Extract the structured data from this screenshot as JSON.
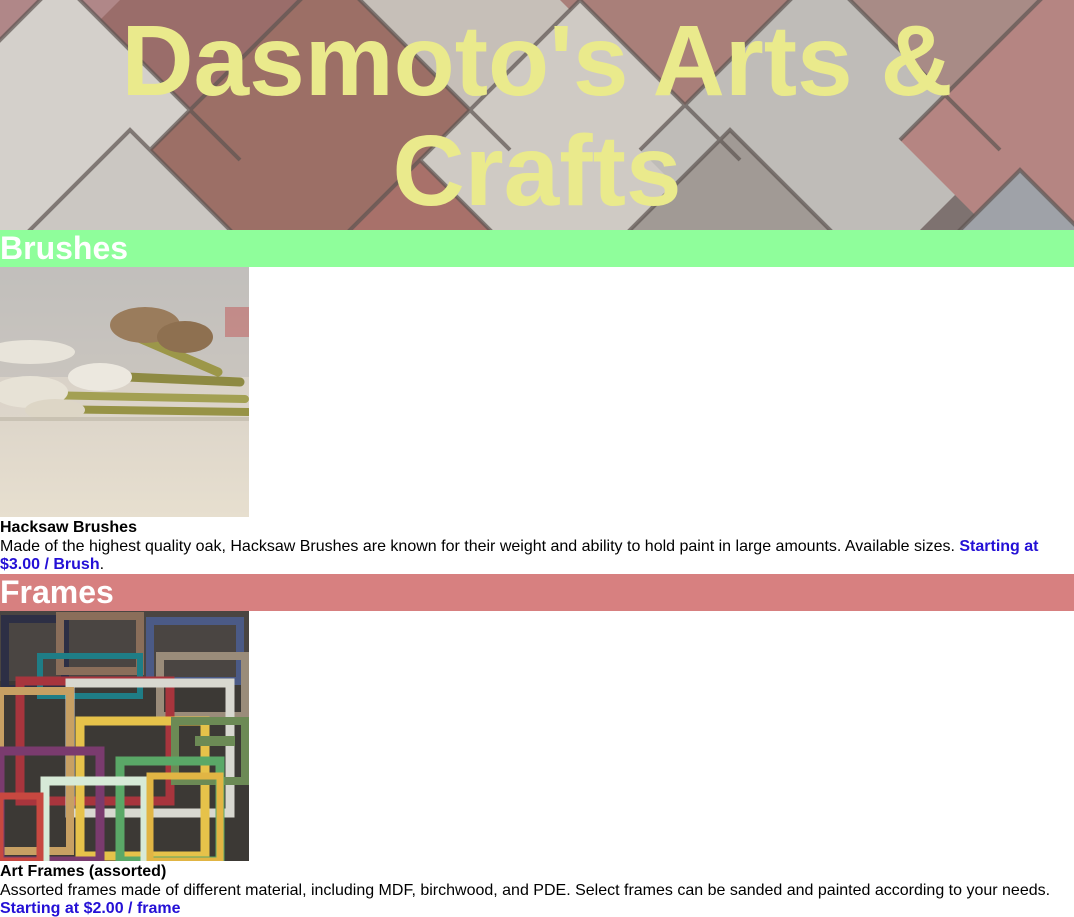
{
  "header": {
    "title": "Dasmoto's Arts & Crafts"
  },
  "sections": [
    {
      "heading": "Brushes",
      "heading_color": "#8ffe9b",
      "image_icon": "paint-brushes-photo",
      "product_name": "Hacksaw Brushes",
      "description": "Made of the highest quality oak, Hacksaw Brushes are known for their weight and ability to hold paint in large amounts. Available sizes.",
      "price": "Starting at $3.00 / Brush",
      "price_suffix": "."
    },
    {
      "heading": "Frames",
      "heading_color": "#d78080",
      "image_icon": "art-frames-photo",
      "product_name": "Art Frames (assorted)",
      "description": "Assorted frames made of different material, including MDF, birchwood, and PDE. Select frames can be sanded and painted according to your needs.",
      "price": "Starting at $2.00 / frame",
      "price_suffix": ""
    }
  ],
  "colors": {
    "title": "#eaea8c",
    "price": "#2410d6"
  }
}
